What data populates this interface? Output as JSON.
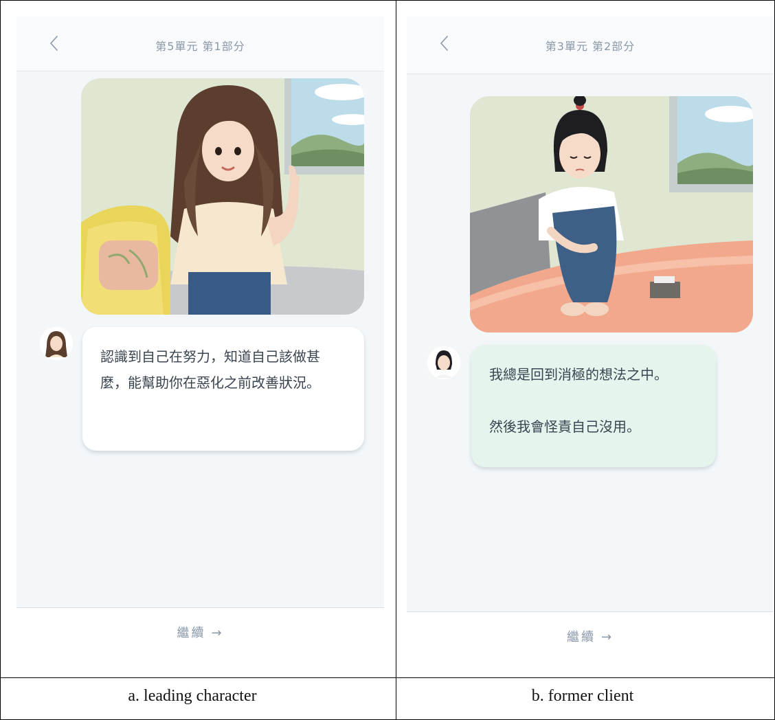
{
  "panel_a": {
    "title": "第5單元 第1部分",
    "message": "認識到自己在努力，知道自己該做甚麼，能幫助你在惡化之前改善狀況。",
    "continue_label": "繼續",
    "continue_arrow": "→",
    "caption": "a. leading character",
    "back_icon": "chevron-left-icon",
    "bubble_color": "#ffffff"
  },
  "panel_b": {
    "title": "第3單元 第2部分",
    "message_lines": [
      "我總是回到消極的想法之中。",
      "然後我會怪責自己沒用。"
    ],
    "continue_label": "繼續",
    "continue_arrow": "→",
    "caption": "b. former client",
    "back_icon": "chevron-left-icon",
    "bubble_color": "#e6f4ee"
  }
}
